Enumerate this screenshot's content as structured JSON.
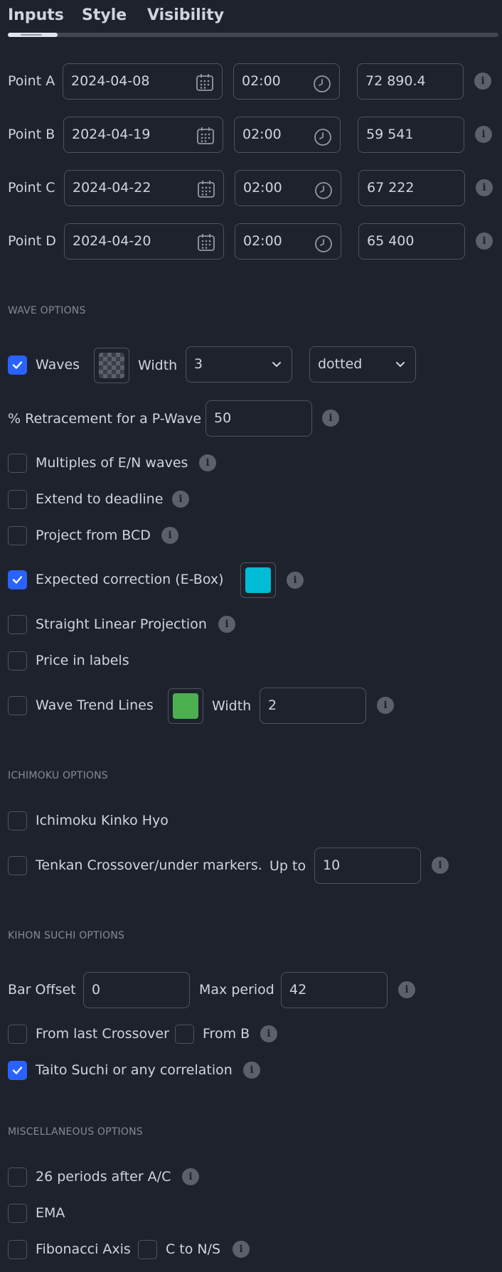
{
  "tabs": [
    {
      "label": "Inputs",
      "active": true
    },
    {
      "label": "Style",
      "active": false
    },
    {
      "label": "Visibility",
      "active": false
    }
  ],
  "points": [
    {
      "label": "Point A",
      "date": "2024-04-08",
      "time": "02:00",
      "price": "72 890.4"
    },
    {
      "label": "Point B",
      "date": "2024-04-19",
      "time": "02:00",
      "price": "59 541"
    },
    {
      "label": "Point C",
      "date": "2024-04-22",
      "time": "02:00",
      "price": "67 222"
    },
    {
      "label": "Point D",
      "date": "2024-04-20",
      "time": "02:00",
      "price": "65 400"
    }
  ],
  "wave_options": {
    "title": "WAVE OPTIONS",
    "waves": {
      "label": "Waves",
      "checked": true,
      "width_label": "Width",
      "width_value": "3",
      "style_value": "dotted"
    },
    "retracement": {
      "label": "% Retracement for a P-Wave",
      "value": "50"
    },
    "multiples": {
      "label": "Multiples of E/N waves",
      "checked": false
    },
    "extend": {
      "label": "Extend to deadline",
      "checked": false
    },
    "project": {
      "label": "Project from BCD",
      "checked": false
    },
    "ebox": {
      "label": "Expected correction (E-Box)",
      "checked": true,
      "color": "#00bcd4"
    },
    "linear": {
      "label": "Straight Linear Projection",
      "checked": false
    },
    "price_labels": {
      "label": "Price in labels",
      "checked": false
    },
    "trend_lines": {
      "label": "Wave Trend Lines",
      "checked": false,
      "color": "#4caf50",
      "width_label": "Width",
      "width_value": "2"
    }
  },
  "ichimoku": {
    "title": "ICHIMOKU OPTIONS",
    "kinko": {
      "label": "Ichimoku Kinko Hyo",
      "checked": false
    },
    "tenkan": {
      "label": "Tenkan Crossover/under markers.",
      "checked": false,
      "upto_label": "Up to",
      "upto_value": "10"
    }
  },
  "kihon": {
    "title": "KIHON SUCHI OPTIONS",
    "bar_offset_label": "Bar Offset",
    "bar_offset_value": "0",
    "max_period_label": "Max period",
    "max_period_value": "42",
    "from_last": {
      "label": "From last Crossover",
      "checked": false
    },
    "from_b": {
      "label": "From B",
      "checked": false
    },
    "taito": {
      "label": "Taito Suchi or any correlation",
      "checked": true
    }
  },
  "misc": {
    "title": "MISCELLANEOUS OPTIONS",
    "periods": {
      "label": "26 periods after A/C",
      "checked": false
    },
    "ema": {
      "label": "EMA",
      "checked": false
    },
    "fib": {
      "label": "Fibonacci Axis",
      "checked": false
    },
    "c_to_ns": {
      "label": "C to N/S",
      "checked": false
    }
  },
  "info_glyph": "i",
  "colors": {
    "accent": "#2962ff",
    "background": "#1e222d",
    "border": "#50535e"
  }
}
